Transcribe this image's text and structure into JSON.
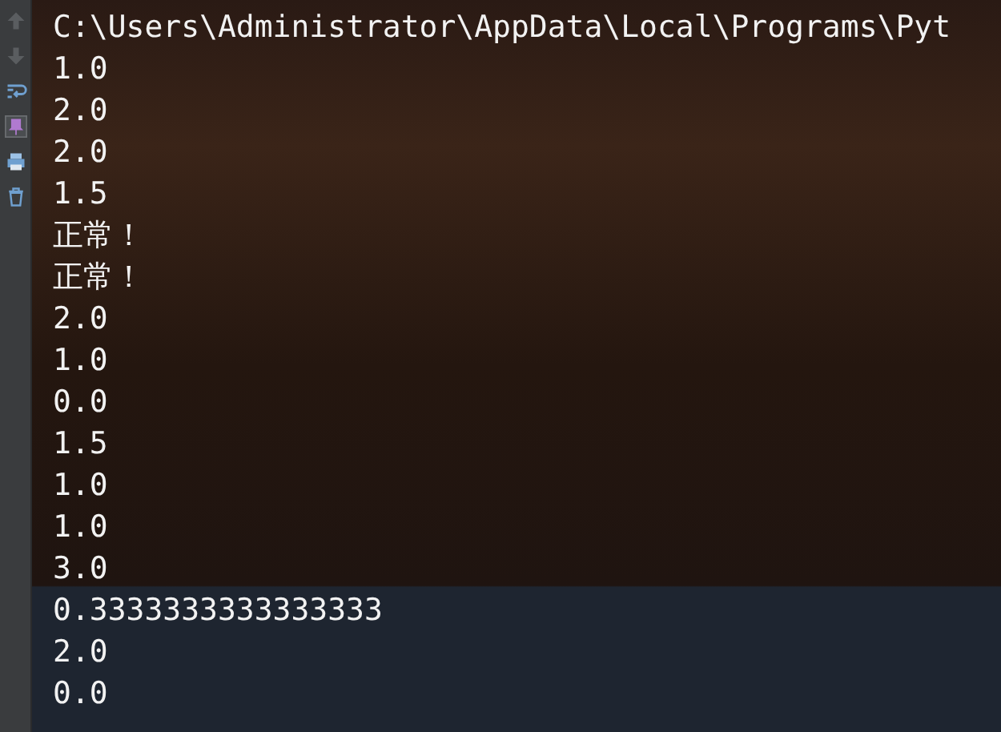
{
  "console": {
    "lines": [
      "C:\\Users\\Administrator\\AppData\\Local\\Programs\\Pyt",
      "1.0",
      "2.0",
      "2.0",
      "1.5",
      "正常！",
      "正常！",
      "2.0",
      "1.0",
      "0.0",
      "1.5",
      "1.0",
      "1.0",
      "3.0",
      "0.3333333333333333",
      "2.0",
      "0.0"
    ]
  }
}
